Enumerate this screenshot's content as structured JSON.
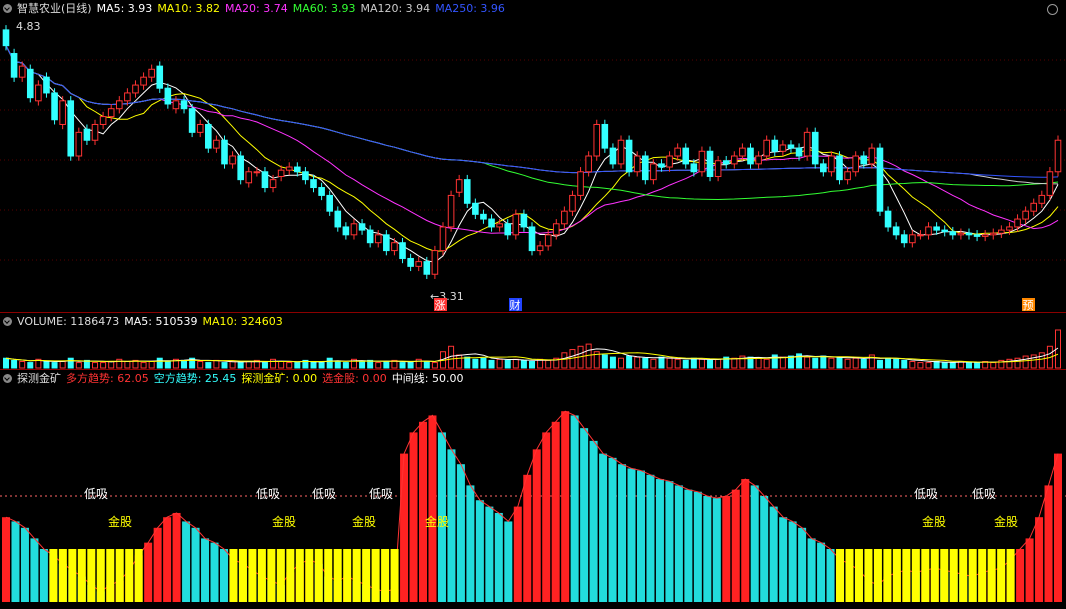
{
  "header1": {
    "title": "智慧农业(日线)",
    "ma": [
      {
        "label": "MA5: 3.93",
        "color": "#ffffff"
      },
      {
        "label": "MA10: 3.82",
        "color": "#ffff00"
      },
      {
        "label": "MA20: 3.74",
        "color": "#ff33ff"
      },
      {
        "label": "MA60: 3.93",
        "color": "#33ff33"
      },
      {
        "label": "MA120: 3.94",
        "color": "#cccccc"
      },
      {
        "label": "MA250: 3.96",
        "color": "#3355ff"
      }
    ]
  },
  "header2": {
    "items": [
      {
        "label": "VOLUME: 1186473",
        "color": "#dddddd"
      },
      {
        "label": "MA5: 510539",
        "color": "#ffffff"
      },
      {
        "label": "MA10: 324603",
        "color": "#ffff00"
      }
    ]
  },
  "header3": {
    "items": [
      {
        "label": "探测金矿",
        "color": "#dddddd"
      },
      {
        "label": "多方趋势: 62.05",
        "color": "#ff3333"
      },
      {
        "label": "空方趋势: 25.45",
        "color": "#33ffff"
      },
      {
        "label": "探测金矿: 0.00",
        "color": "#ffff00"
      },
      {
        "label": "选金股: 0.00",
        "color": "#ff3333"
      },
      {
        "label": "中间线: 50.00",
        "color": "#ffffff"
      }
    ]
  },
  "price_labels": {
    "high": "4.83",
    "low": "3.31"
  },
  "markers": [
    {
      "text": "涨",
      "x": 440,
      "bg": "#ff3333",
      "fg": "#ffffff"
    },
    {
      "text": "财",
      "x": 515,
      "bg": "#2244ff",
      "fg": "#ffffff"
    },
    {
      "text": "预",
      "x": 1028,
      "bg": "#ff8800",
      "fg": "#ffffff"
    }
  ],
  "signals": [
    {
      "text": "低吸",
      "x": 96,
      "row": "low"
    },
    {
      "text": "金股",
      "x": 120,
      "row": "gold"
    },
    {
      "text": "低吸",
      "x": 268,
      "row": "low"
    },
    {
      "text": "金股",
      "x": 284,
      "row": "gold"
    },
    {
      "text": "低吸",
      "x": 324,
      "row": "low"
    },
    {
      "text": "低吸",
      "x": 381,
      "row": "low"
    },
    {
      "text": "金股",
      "x": 364,
      "row": "gold"
    },
    {
      "text": "金股",
      "x": 437,
      "row": "gold"
    },
    {
      "text": "低吸",
      "x": 926,
      "row": "low"
    },
    {
      "text": "金股",
      "x": 934,
      "row": "gold"
    },
    {
      "text": "低吸",
      "x": 984,
      "row": "low"
    },
    {
      "text": "金股",
      "x": 1006,
      "row": "gold"
    }
  ],
  "chart_data": [
    {
      "type": "candlestick",
      "ylim": [
        3.2,
        4.9
      ],
      "close": [
        4.75,
        4.55,
        4.62,
        4.42,
        4.5,
        4.45,
        4.28,
        4.4,
        4.05,
        4.2,
        4.15,
        4.25,
        4.3,
        4.35,
        4.4,
        4.45,
        4.5,
        4.55,
        4.6,
        4.48,
        4.38,
        4.4,
        4.35,
        4.2,
        4.25,
        4.1,
        4.15,
        4.0,
        4.05,
        3.9,
        3.95,
        3.95,
        3.85,
        3.9,
        3.96,
        3.98,
        3.95,
        3.9,
        3.85,
        3.8,
        3.7,
        3.6,
        3.55,
        3.62,
        3.58,
        3.5,
        3.55,
        3.45,
        3.5,
        3.4,
        3.35,
        3.38,
        3.3,
        3.45,
        3.6,
        3.8,
        3.9,
        3.75,
        3.68,
        3.65,
        3.6,
        3.62,
        3.55,
        3.68,
        3.6,
        3.45,
        3.48,
        3.55,
        3.62,
        3.7,
        3.8,
        3.95,
        4.05,
        4.25,
        4.1,
        4.0,
        4.15,
        3.95,
        4.05,
        3.9,
        4.0,
        3.98,
        4.05,
        4.1,
        4.0,
        3.95,
        4.08,
        3.92,
        4.02,
        4.0,
        4.05,
        4.1,
        4.0,
        4.05,
        4.15,
        4.08,
        4.12,
        4.1,
        4.05,
        4.2,
        4.0,
        3.95,
        4.05,
        3.9,
        3.95,
        4.05,
        4.0,
        4.1,
        3.7,
        3.6,
        3.55,
        3.5,
        3.55,
        3.55,
        3.6,
        3.58,
        3.57,
        3.55,
        3.56,
        3.55,
        3.54,
        3.55,
        3.56,
        3.58,
        3.6,
        3.65,
        3.7,
        3.75,
        3.8,
        3.95,
        4.15
      ],
      "open": [
        4.85,
        4.7,
        4.55,
        4.6,
        4.4,
        4.55,
        4.45,
        4.25,
        4.4,
        4.05,
        4.22,
        4.15,
        4.25,
        4.3,
        4.35,
        4.4,
        4.45,
        4.5,
        4.55,
        4.62,
        4.48,
        4.35,
        4.4,
        4.35,
        4.2,
        4.25,
        4.1,
        4.15,
        4.0,
        4.05,
        3.88,
        3.95,
        3.95,
        3.85,
        3.92,
        3.96,
        3.98,
        3.95,
        3.9,
        3.85,
        3.8,
        3.7,
        3.6,
        3.55,
        3.62,
        3.58,
        3.5,
        3.55,
        3.45,
        3.5,
        3.4,
        3.35,
        3.38,
        3.3,
        3.45,
        3.6,
        3.82,
        3.9,
        3.75,
        3.68,
        3.65,
        3.6,
        3.62,
        3.55,
        3.68,
        3.6,
        3.45,
        3.48,
        3.55,
        3.62,
        3.7,
        3.8,
        3.95,
        4.05,
        4.25,
        4.1,
        4.0,
        4.15,
        3.95,
        4.05,
        3.9,
        4.0,
        3.98,
        4.05,
        4.1,
        4.0,
        3.95,
        4.08,
        3.92,
        4.02,
        4.0,
        4.05,
        4.1,
        4.0,
        4.05,
        4.15,
        4.08,
        4.12,
        4.1,
        4.05,
        4.2,
        4.0,
        3.95,
        4.05,
        3.9,
        3.95,
        4.05,
        4.0,
        4.1,
        3.7,
        3.6,
        3.55,
        3.5,
        3.55,
        3.55,
        3.6,
        3.58,
        3.57,
        3.55,
        3.56,
        3.55,
        3.54,
        3.55,
        3.56,
        3.58,
        3.6,
        3.65,
        3.7,
        3.75,
        3.8,
        3.95
      ],
      "low_price": 3.31,
      "high_price": 4.83
    },
    {
      "type": "bar",
      "title": "VOLUME",
      "values": [
        9,
        7,
        6,
        5,
        8,
        6,
        5,
        6,
        9,
        5,
        7,
        5,
        5,
        6,
        8,
        6,
        7,
        5,
        6,
        9,
        6,
        8,
        7,
        9,
        6,
        5,
        7,
        5,
        6,
        5,
        6,
        7,
        5,
        8,
        6,
        5,
        5,
        7,
        6,
        5,
        9,
        6,
        5,
        8,
        6,
        7,
        5,
        6,
        7,
        5,
        6,
        8,
        6,
        5,
        15,
        20,
        12,
        10,
        8,
        9,
        7,
        8,
        7,
        8,
        7,
        6,
        8,
        7,
        9,
        14,
        17,
        20,
        22,
        15,
        12,
        10,
        9,
        11,
        10,
        9,
        8,
        10,
        9,
        8,
        7,
        9,
        8,
        7,
        8,
        10,
        9,
        11,
        10,
        9,
        8,
        12,
        10,
        11,
        13,
        10,
        9,
        11,
        9,
        10,
        8,
        9,
        8,
        12,
        7,
        9,
        8,
        7,
        6,
        5,
        5,
        6,
        5,
        5,
        6,
        5,
        5,
        6,
        5,
        7,
        8,
        9,
        11,
        12,
        14,
        20,
        35
      ]
    },
    {
      "type": "bar",
      "title": "探测金矿",
      "ylim": [
        0,
        100
      ],
      "midline": 50,
      "values": [
        40,
        38,
        35,
        30,
        25,
        22,
        18,
        15,
        12,
        8,
        5,
        8,
        10,
        15,
        22,
        28,
        35,
        40,
        42,
        38,
        35,
        30,
        28,
        25,
        20,
        18,
        15,
        12,
        10,
        8,
        14,
        18,
        20,
        18,
        12,
        10,
        12,
        10,
        8,
        6,
        5,
        6,
        70,
        80,
        85,
        88,
        80,
        72,
        65,
        55,
        48,
        45,
        42,
        38,
        45,
        60,
        72,
        80,
        85,
        90,
        88,
        82,
        76,
        70,
        68,
        65,
        63,
        62,
        60,
        58,
        57,
        55,
        53,
        52,
        50,
        49,
        50,
        53,
        58,
        55,
        50,
        45,
        40,
        38,
        35,
        30,
        28,
        25,
        20,
        18,
        15,
        10,
        8,
        12,
        14,
        15,
        14,
        15,
        16,
        15,
        14,
        13,
        12,
        14,
        15,
        16,
        20,
        25,
        30,
        40,
        55,
        70
      ],
      "bull_trend": 62.05,
      "bear_trend": 25.45,
      "detect_gold": 0.0,
      "select_gold": 0.0
    }
  ]
}
